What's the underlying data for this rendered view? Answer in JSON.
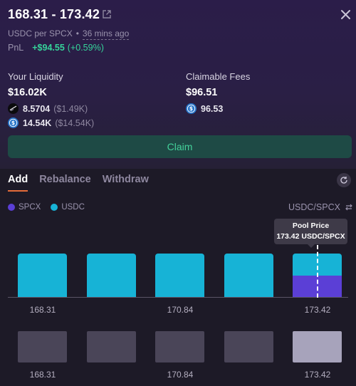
{
  "header": {
    "range": "168.31 - 173.42",
    "pair_unit": "USDC per SPCX",
    "separator": "•",
    "time_ago": "36 mins ago",
    "pnl_label": "PnL",
    "pnl_value": "+$94.55",
    "pnl_pct": "(+0.59%)"
  },
  "liquidity": {
    "label": "Your Liquidity",
    "value": "$16.02K",
    "tokens": [
      {
        "icon": "spcx-token-icon",
        "amount": "8.5704",
        "usd": "($1.49K)"
      },
      {
        "icon": "usdc-token-icon",
        "amount": "14.54K",
        "usd": "($14.54K)"
      }
    ]
  },
  "fees": {
    "label": "Claimable Fees",
    "value": "$96.51",
    "tokens": [
      {
        "icon": "usdc-token-icon",
        "amount": "96.53"
      }
    ]
  },
  "claim_label": "Claim",
  "tabs": [
    "Add",
    "Rebalance",
    "Withdraw"
  ],
  "legend": [
    {
      "label": "SPCX",
      "color": "#5b3fd6"
    },
    {
      "label": "USDC",
      "color": "#17b3d6"
    }
  ],
  "pair_toggle": "USDC/SPCX",
  "tooltip": {
    "title": "Pool Price",
    "value": "173.42 USDC/SPCX"
  },
  "chart_data": [
    {
      "type": "bar",
      "categories": [
        "168.31",
        "",
        "170.84",
        "",
        "173.42"
      ],
      "series": [
        {
          "name": "USDC",
          "values": [
            1,
            1,
            1,
            1,
            0.5
          ]
        },
        {
          "name": "SPCX",
          "values": [
            0,
            0,
            0,
            0,
            0.5
          ]
        }
      ],
      "tick_labels": [
        "168.31",
        "170.84",
        "173.42"
      ],
      "marker": {
        "label": "Pool Price",
        "x": "173.42"
      },
      "colors": {
        "USDC": "#17b3d6",
        "SPCX": "#5b3fd6"
      }
    },
    {
      "type": "bar",
      "categories": [
        "168.31",
        "",
        "170.84",
        "",
        "173.42"
      ],
      "values": [
        1,
        1,
        1,
        1,
        1
      ],
      "tick_labels": [
        "168.31",
        "170.84",
        "173.42"
      ],
      "colors": {
        "default": "#4a4558",
        "highlight": "#a7a3bb"
      }
    }
  ]
}
